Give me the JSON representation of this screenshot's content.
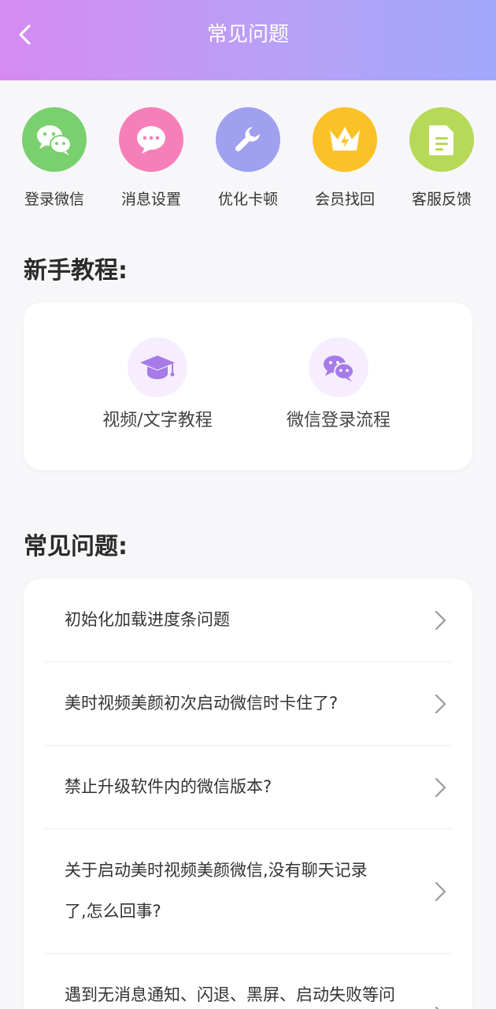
{
  "header": {
    "title": "常见问题"
  },
  "quick_actions": [
    {
      "label": "登录微信",
      "icon": "wechat-icon",
      "color": "#7ad06e"
    },
    {
      "label": "消息设置",
      "icon": "message-icon",
      "color": "#f77fb9"
    },
    {
      "label": "优化卡顿",
      "icon": "wrench-icon",
      "color": "#9fa0f0"
    },
    {
      "label": "会员找回",
      "icon": "crown-icon",
      "color": "#fbc127"
    },
    {
      "label": "客服反馈",
      "icon": "document-icon",
      "color": "#b6d958"
    }
  ],
  "tutorial": {
    "title": "新手教程:",
    "items": [
      {
        "label": "视频/文字教程",
        "icon": "graduation-cap-icon"
      },
      {
        "label": "微信登录流程",
        "icon": "wechat-icon"
      }
    ]
  },
  "faq": {
    "title": "常见问题:",
    "items": [
      {
        "line1": "初始化加载进度条问题",
        "line2": ""
      },
      {
        "line1": "美时视频美颜初次启动微信时卡住了?",
        "line2": ""
      },
      {
        "line1": "禁止升级软件内的微信版本?",
        "line2": ""
      },
      {
        "line1": "关于启动美时视频美颜微信,没有聊天记录",
        "line2": "了,怎么回事?"
      },
      {
        "line1": "遇到无消息通知、闪退、黑屏、启动失败等问",
        "line2": ""
      }
    ]
  },
  "colors": {
    "accent_start": "#d68af3",
    "accent_end": "#a0a8fb",
    "tutorial_icon": "#a67be8"
  }
}
